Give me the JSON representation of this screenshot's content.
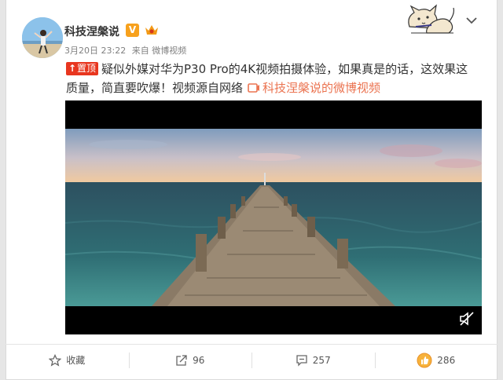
{
  "author": {
    "name": "科技涅槃说",
    "verified_badge": "V",
    "avatar_icon": "avatar",
    "crown_icon": "crown-icon"
  },
  "meta": {
    "time": "3月20日 23:22",
    "source_prefix": "来自",
    "source": "微博视频"
  },
  "post": {
    "pin_label": "置顶",
    "text": "疑似外媒对华为P30 Pro的4K视频拍摄体验，如果真是的话，这效果这质量，简直要吹爆！视频源自网络",
    "video_link": "科技涅槃说的微博视频"
  },
  "actions": [
    {
      "icon": "star-icon",
      "label": "收藏"
    },
    {
      "icon": "share-icon",
      "label": "96"
    },
    {
      "icon": "comment-icon",
      "label": "257"
    },
    {
      "icon": "thumbs-up-icon",
      "label": "286"
    }
  ],
  "colors": {
    "accent": "#eb7350",
    "pin_red": "#e8361f",
    "vip_orange": "#f7a11d",
    "text": "#333333",
    "meta": "#808080"
  }
}
